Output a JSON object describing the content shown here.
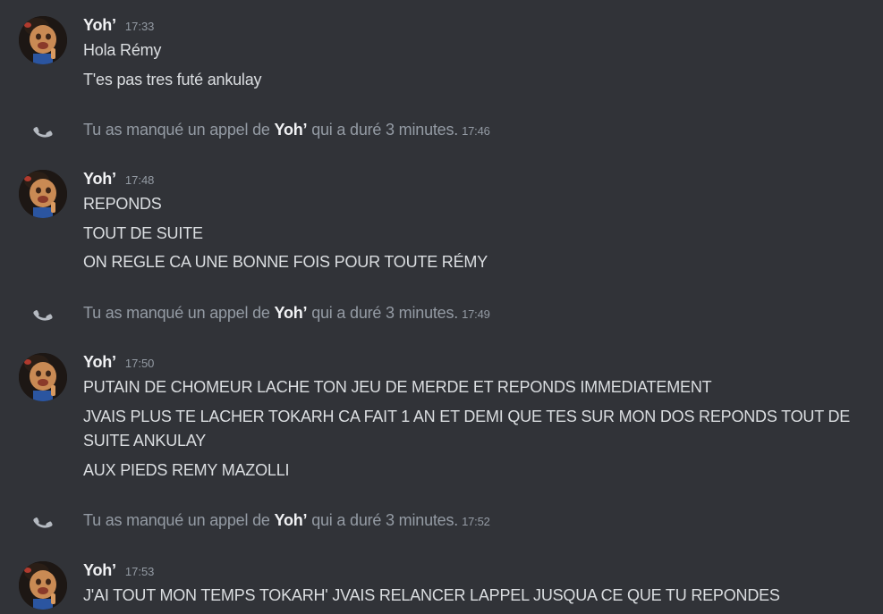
{
  "colors": {
    "background": "#313338",
    "text": "#dbdee1",
    "muted": "#949ba4",
    "author": "#f2f3f5",
    "phone_icon": "#b5bac1"
  },
  "groups": [
    {
      "author": "Yoh’",
      "time": "17:33",
      "avatar_icon": "user-avatar",
      "lines": [
        "Hola Rémy",
        "T'es pas tres futé ankulay"
      ]
    },
    {
      "author": "Yoh’",
      "time": "17:48",
      "avatar_icon": "user-avatar",
      "lines": [
        "REPONDS",
        "TOUT DE SUITE",
        "ON REGLE CA UNE BONNE FOIS POUR TOUTE RÉMY"
      ]
    },
    {
      "author": "Yoh’",
      "time": "17:50",
      "avatar_icon": "user-avatar",
      "lines": [
        "PUTAIN DE CHOMEUR LACHE TON JEU DE MERDE ET REPONDS IMMEDIATEMENT",
        "JVAIS PLUS TE LACHER TOKARH CA FAIT 1 AN ET DEMI QUE TES SUR MON DOS REPONDS TOUT DE",
        "SUITE ANKULAY",
        "AUX PIEDS REMY MAZOLLI"
      ]
    },
    {
      "author": "Yoh’",
      "time": "17:53",
      "avatar_icon": "user-avatar",
      "lines": [
        "J'AI TOUT MON TEMPS TOKARH' JVAIS RELANCER LAPPEL JUSQUA CE QUE TU REPONDES"
      ]
    }
  ],
  "missed_calls": [
    {
      "prefix": "Tu as manqué un appel de",
      "caller": "Yoh’",
      "suffix": "qui a duré 3 minutes.",
      "time": "17:46",
      "icon": "phone-icon"
    },
    {
      "prefix": "Tu as manqué un appel de",
      "caller": "Yoh’",
      "suffix": "qui a duré 3 minutes.",
      "time": "17:49",
      "icon": "phone-icon"
    },
    {
      "prefix": "Tu as manqué un appel de",
      "caller": "Yoh’",
      "suffix": "qui a duré 3 minutes.",
      "time": "17:52",
      "icon": "phone-icon"
    }
  ]
}
